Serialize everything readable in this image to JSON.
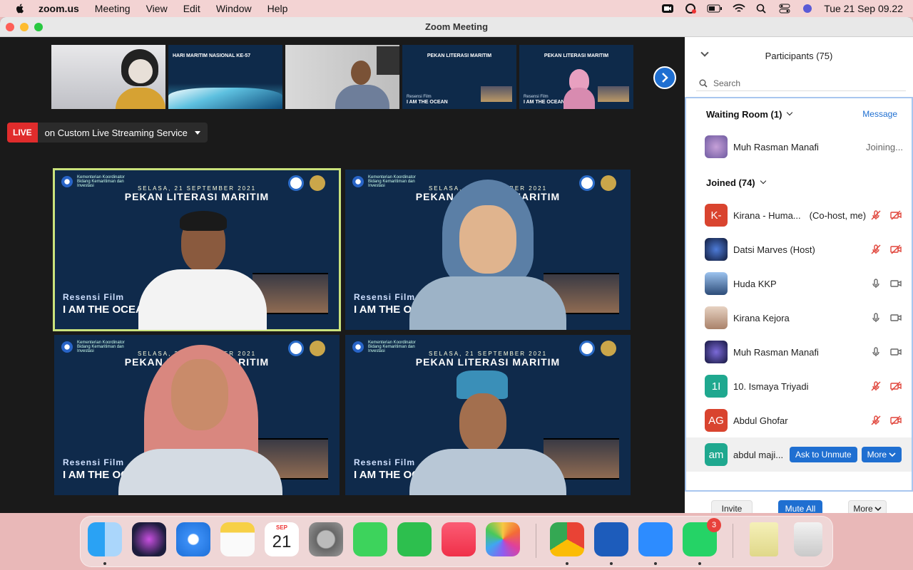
{
  "menubar": {
    "app_name": "zoom.us",
    "menus": [
      "Meeting",
      "View",
      "Edit",
      "Window",
      "Help"
    ],
    "clock": "Tue 21 Sep  09.22"
  },
  "window": {
    "title": "Zoom Meeting"
  },
  "thumbnails": [
    {
      "kind": "photo"
    },
    {
      "kind": "screen",
      "title": "HARI MARITIM NASIONAL KE-57"
    },
    {
      "kind": "photo"
    },
    {
      "kind": "screen",
      "title": "PEKAN LITERASI MARITIM",
      "sub": "Resensi Film",
      "sub2": "I AM THE OCEAN"
    },
    {
      "kind": "screen",
      "title": "PEKAN LITERASI MARITIM",
      "sub": "Resensi Film",
      "sub2": "I AM THE OCEAN"
    }
  ],
  "live": {
    "badge": "LIVE",
    "text": "on Custom Live Streaming Service"
  },
  "tiles": [
    {
      "ministry": "Kementerian Koordinator Bidang Kemaritiman dan Investasi",
      "date": "SELASA, 21 SEPTEMBER 2021",
      "event": "PEKAN LITERASI MARITIM",
      "film_label": "Resensi Film",
      "film_title": "I AM THE OCEAN"
    },
    {
      "ministry": "Kementerian Koordinator Bidang Kemaritiman dan Investasi",
      "date": "SELASA, 21 SEPTEMBER 2021",
      "event": "PEKAN LITERASI MARITIM",
      "film_label": "Resensi Film",
      "film_title": "I AM THE OCEAN"
    },
    {
      "ministry": "Kementerian Koordinator Bidang Kemaritiman dan Investasi",
      "date": "SELASA, 21 SEPTEMBER 2021",
      "event": "PEKAN LITERASI MARITIM",
      "film_label": "Resensi Film",
      "film_title": "I AM THE OCEAN"
    },
    {
      "ministry": "Kementerian Koordinator Bidang Kemaritiman dan Investasi",
      "date": "SELASA, 21 SEPTEMBER 2021",
      "event": "PEKAN LITERASI MARITIM",
      "film_label": "Resensi Film",
      "film_title": "I AM THE OC"
    }
  ],
  "panel": {
    "title": "Participants (75)",
    "search_placeholder": "Search",
    "waiting_room": {
      "label": "Waiting Room (1)",
      "message": "Message",
      "participant": {
        "name": "Muh Rasman Manafi",
        "status": "Joining..."
      }
    },
    "joined": {
      "label": "Joined (74)",
      "participants": [
        {
          "initials": "K-",
          "name": "Kirana - Huma...",
          "role": "(Co-host, me)",
          "avatar_color": "#d9442f",
          "mic": "muted",
          "video": "off"
        },
        {
          "initials": "",
          "name": "Datsi Marves (Host)",
          "role": "",
          "avatar_color": "#1b2a55",
          "mic": "muted",
          "video": "off"
        },
        {
          "initials": "",
          "name": "Huda KKP",
          "role": "",
          "avatar_color": "#4a6b9a",
          "mic": "on",
          "video": "on"
        },
        {
          "initials": "",
          "name": "Kirana Kejora",
          "role": "",
          "avatar_color": "#c9a28a",
          "mic": "on",
          "video": "on"
        },
        {
          "initials": "",
          "name": "Muh Rasman Manafi",
          "role": "",
          "avatar_color": "#2a2f6a",
          "mic": "on",
          "video": "on"
        },
        {
          "initials": "1I",
          "name": "10. Ismaya Triyadi",
          "role": "",
          "avatar_color": "#1fa88f",
          "mic": "muted",
          "video": "off"
        },
        {
          "initials": "AG",
          "name": "Abdul Ghofar",
          "role": "",
          "avatar_color": "#d9442f",
          "mic": "muted",
          "video": "off"
        }
      ],
      "last": {
        "initials": "am",
        "name": "abdul maji...",
        "avatar_color": "#1fa88f",
        "ask_label": "Ask to Unmute",
        "more_label": "More"
      }
    },
    "footer": {
      "invite": "Invite",
      "mute_all": "Mute All",
      "more": "More"
    }
  },
  "dock": {
    "calendar_month": "SEP",
    "calendar_day": "21",
    "whatsapp_badge": "3"
  }
}
